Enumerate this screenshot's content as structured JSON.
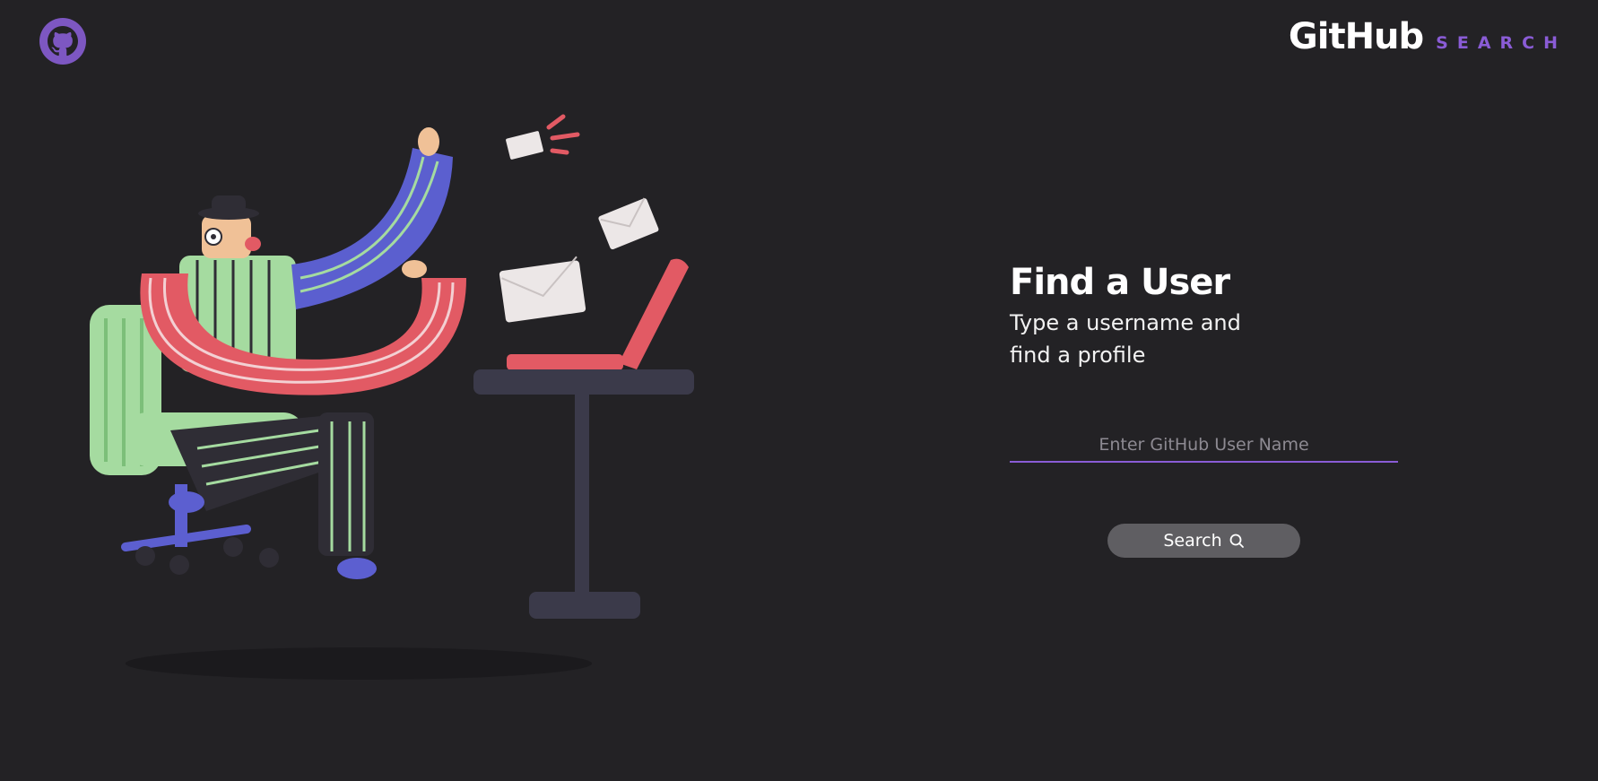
{
  "header": {
    "logo_icon": "github-octocat-icon",
    "brand_name": "GitHub",
    "brand_sub": "SEARCH",
    "accent_color": "#8a5cd6"
  },
  "hero": {
    "illustration": "person-sending-mail-illustration"
  },
  "search_panel": {
    "title": "Find a User",
    "subtitle": "Type a username and find a profile",
    "input": {
      "placeholder": "Enter GitHub User Name",
      "value": ""
    },
    "button_label": "Search",
    "button_icon": "search-icon"
  }
}
